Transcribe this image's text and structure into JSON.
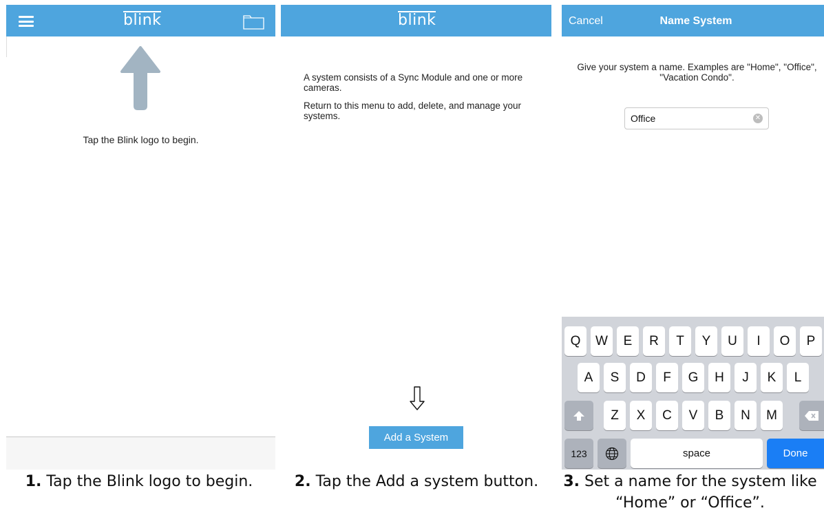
{
  "panel1": {
    "logo": "blink",
    "instruction": "Tap the Blink logo to begin.",
    "icons": {
      "menu": "hamburger-icon",
      "folder": "folder-icon",
      "arrow": "up-arrow-icon"
    },
    "colors": {
      "bar": "#4ea5de",
      "arrow": "#a2b4c2"
    }
  },
  "panel2": {
    "logo": "blink",
    "paragraph1": "A system consists of a Sync Module and one or more cameras.",
    "paragraph2": "Return to this menu to add, delete, and manage your systems.",
    "add_button": "Add a System",
    "icons": {
      "arrow": "down-arrow-icon"
    }
  },
  "panel3": {
    "cancel": "Cancel",
    "title": "Name System",
    "instruction": "Give your system a name. Examples are \"Home\", \"Office\", \"Vacation Condo\".",
    "name_value": "Office",
    "keyboard": {
      "row1": [
        "Q",
        "W",
        "E",
        "R",
        "T",
        "Y",
        "U",
        "I",
        "O",
        "P"
      ],
      "row2": [
        "A",
        "S",
        "D",
        "F",
        "G",
        "H",
        "J",
        "K",
        "L"
      ],
      "row3": [
        "Z",
        "X",
        "C",
        "V",
        "B",
        "N",
        "M"
      ],
      "numbers": "123",
      "space": "space",
      "done": "Done",
      "icons": {
        "shift": "shift-icon",
        "globe": "globe-icon",
        "delete": "backspace-icon"
      }
    },
    "colors": {
      "done": "#1a7ef5",
      "keyboard": "#d1d4da"
    }
  },
  "captions": [
    {
      "number": "1.",
      "text": " Tap the Blink logo to begin."
    },
    {
      "number": "2.",
      "text": " Tap the Add a system button."
    },
    {
      "number": "3.",
      "text": " Set a name for the system like “Home” or “Office”."
    }
  ]
}
